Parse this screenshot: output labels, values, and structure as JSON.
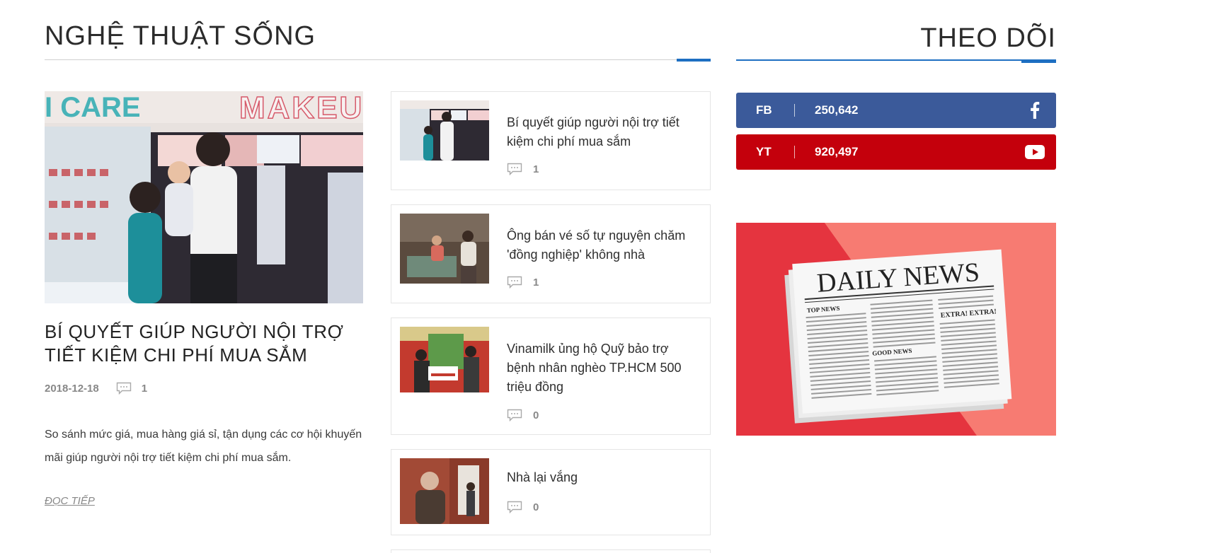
{
  "left_section": {
    "title": "NGHỆ THUẬT SỐNG",
    "feature": {
      "title": "BÍ QUYẾT GIÚP NGƯỜI NỘI TRỢ TIẾT KIỆM CHI PHÍ MUA SẮM",
      "date": "2018-12-18",
      "comments": "1",
      "excerpt": "So sánh mức giá, mua hàng giá sỉ, tận dụng các cơ hội khuyến mãi giúp người nội trợ tiết kiệm chi phí mua sắm.",
      "read_more": "ĐỌC TIẾP",
      "image_signage_1": "I CARE",
      "image_signage_2": "MAKEU"
    },
    "articles": [
      {
        "title": "Bí quyết giúp người nội trợ tiết kiệm chi phí mua sắm",
        "comments": "1"
      },
      {
        "title": "Ông bán vé số tự nguyện chăm 'đồng nghiệp' không nhà",
        "comments": "1"
      },
      {
        "title": "Vinamilk ủng hộ Quỹ bảo trợ bệnh nhân nghèo TP.HCM 500 triệu đồng",
        "comments": "0"
      },
      {
        "title": "Nhà lại vắng",
        "comments": "0"
      }
    ]
  },
  "right_section": {
    "title": "THEO DÕI",
    "social": [
      {
        "abbr": "FB",
        "count": "250,642",
        "icon": "facebook-icon",
        "color": "#3b5a9a"
      },
      {
        "abbr": "YT",
        "count": "920,497",
        "icon": "youtube-icon",
        "color": "#c4000c"
      }
    ],
    "ad": {
      "masthead": "DAILY NEWS",
      "col_head_1": "TOP NEWS",
      "col_head_2": "EXTRA! EXTRA!",
      "col_head_3": "GOOD NEWS"
    }
  },
  "colors": {
    "accent": "#1e6fc2",
    "facebook": "#3b5a9a",
    "youtube": "#c4000c"
  }
}
